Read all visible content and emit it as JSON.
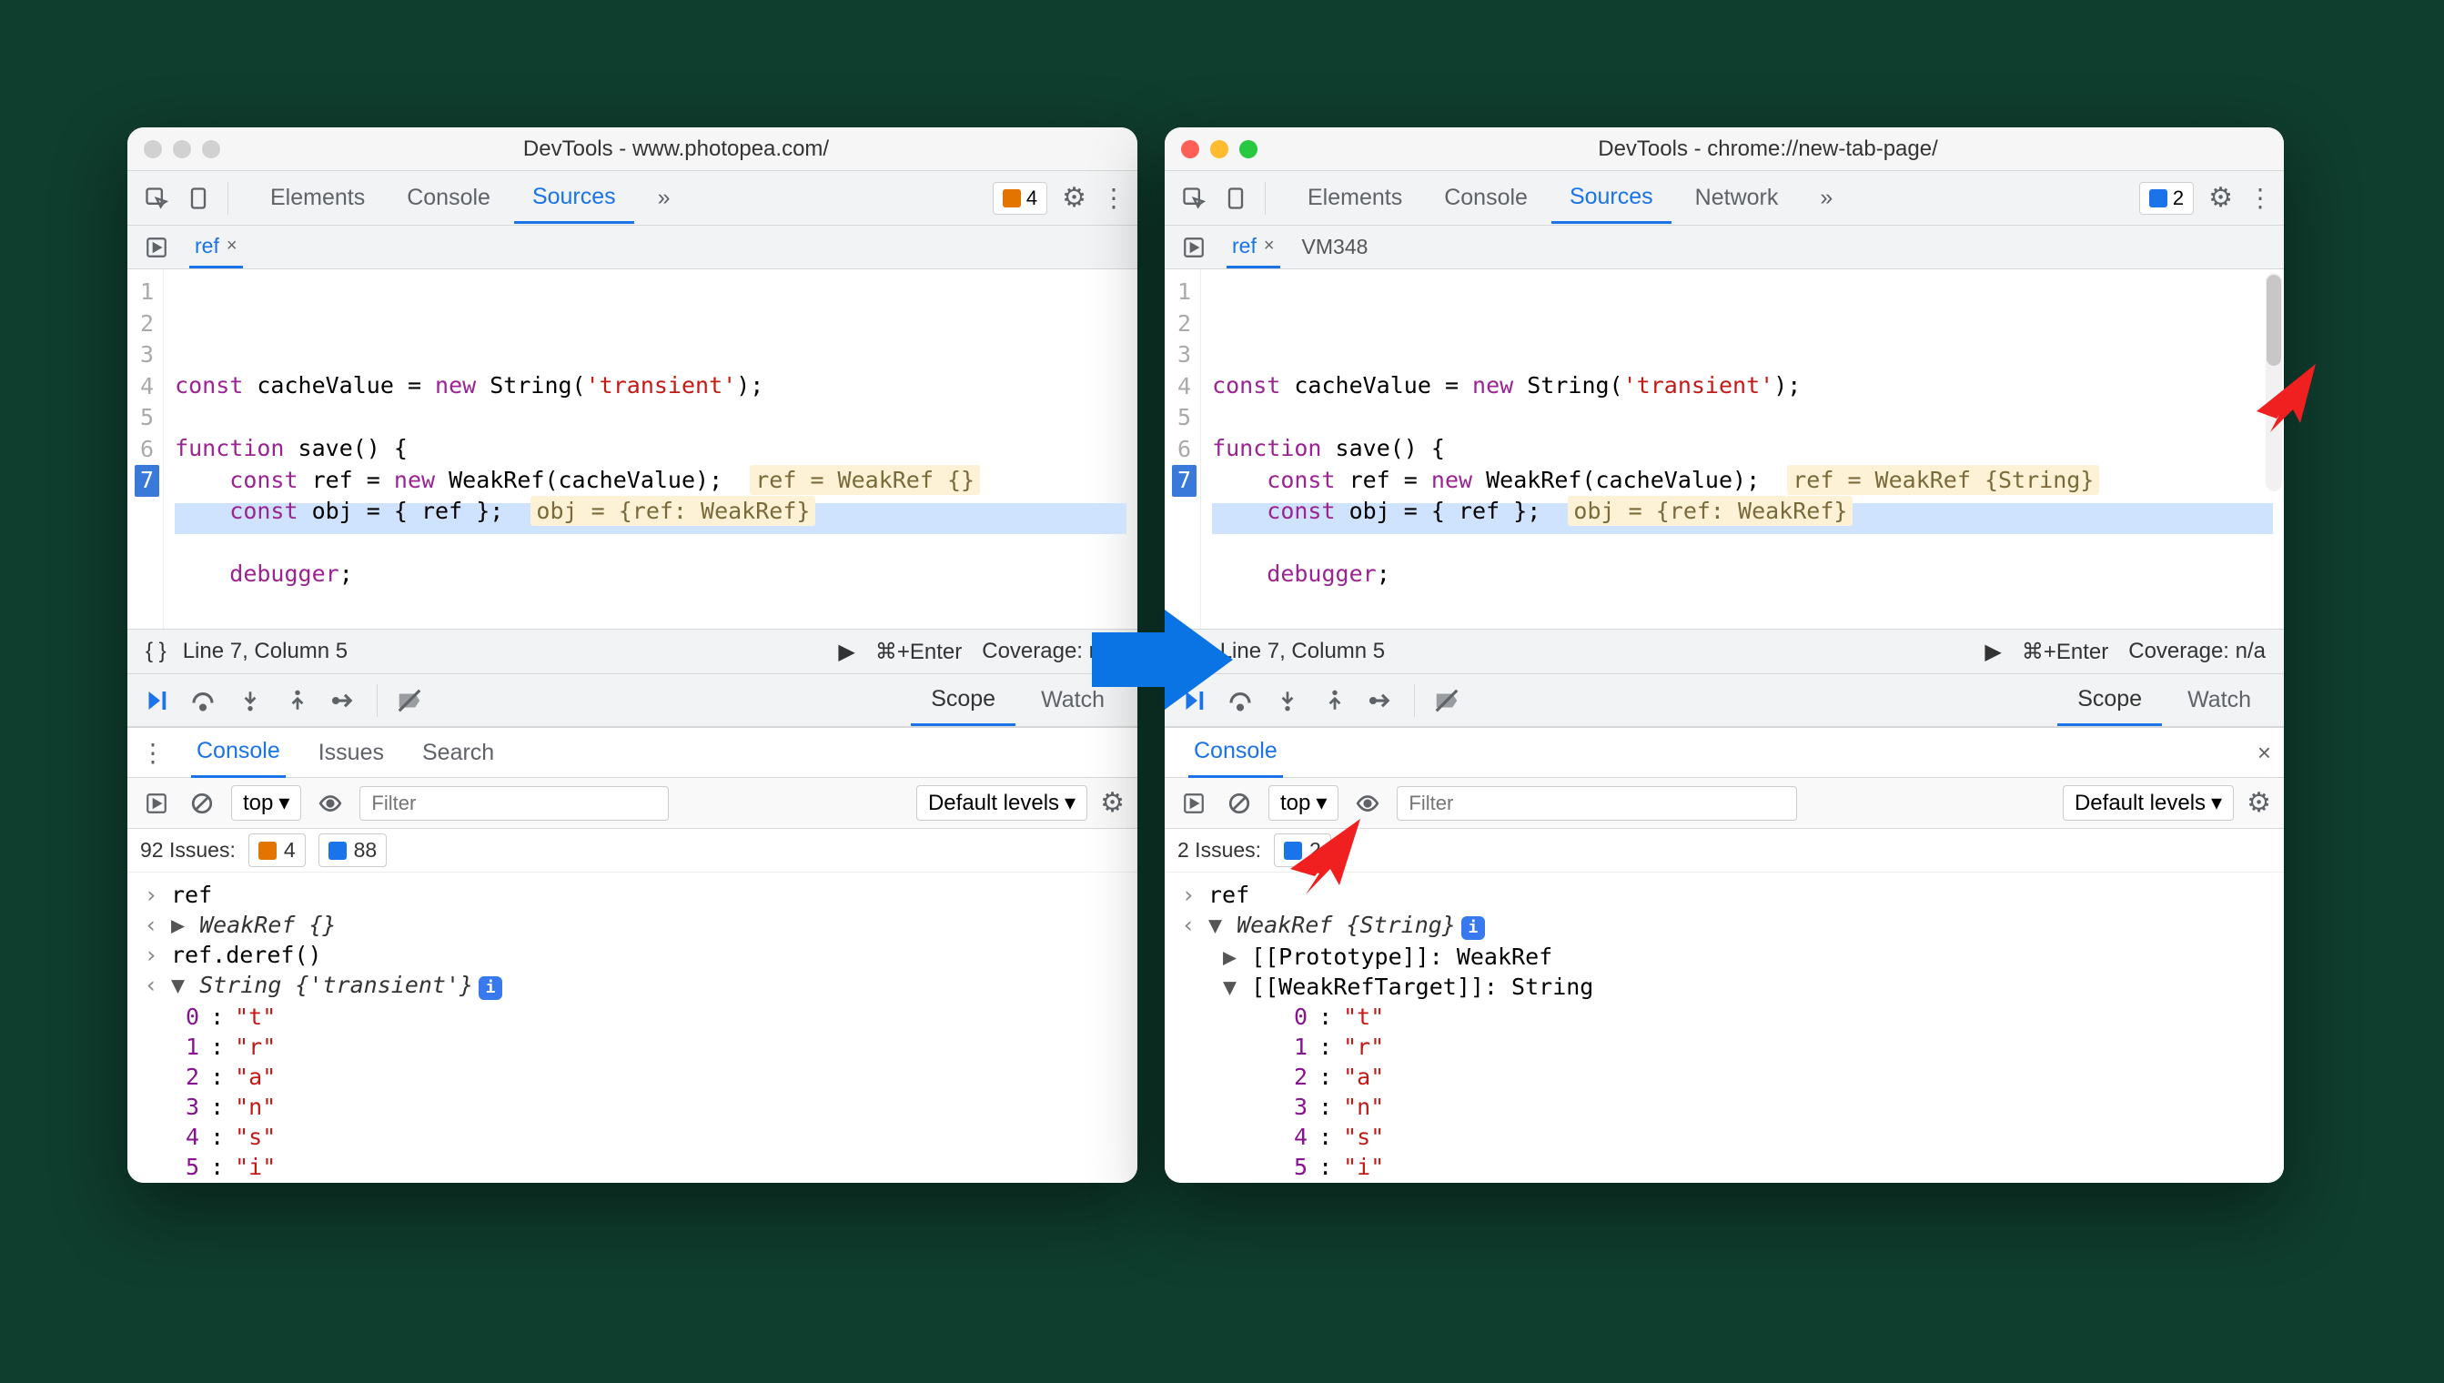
{
  "left": {
    "title": "DevTools - www.photopea.com/",
    "tabs": [
      "Elements",
      "Console",
      "Sources"
    ],
    "activeTab": "Sources",
    "badgeOrange": "4",
    "fileTabs": {
      "active": "ref"
    },
    "code": {
      "lines": [
        "1",
        "2",
        "3",
        "4",
        "5",
        "6",
        "7"
      ],
      "t1a": "const",
      "t1b": " cacheValue = ",
      "t1c": "new",
      "t1d": " String(",
      "t1e": "'transient'",
      "t1f": ");",
      "t3a": "function",
      "t3b": " save() {",
      "t4a": "    const",
      "t4b": " ref = ",
      "t4c": "new",
      "t4d": " WeakRef(cacheValue);  ",
      "t4hint": "ref = WeakRef {}",
      "t5a": "    const",
      "t5b": " obj = { ref };  ",
      "t5hint": "obj = {ref: WeakRef}",
      "t7a": "    debugger",
      "t7b": ";"
    },
    "status": {
      "pos": "Line 7, Column 5",
      "run": "⌘+Enter",
      "coverage": "Coverage: n/a"
    },
    "scope": {
      "tabs": [
        "Scope",
        "Watch"
      ],
      "active": "Scope"
    },
    "drawer": {
      "tabs": [
        "Console",
        "Issues",
        "Search"
      ],
      "active": "Console"
    },
    "filter": {
      "context": "top",
      "placeholder": "Filter",
      "levels": "Default levels"
    },
    "issues": {
      "count": "92 Issues:",
      "orange": "4",
      "blue": "88"
    },
    "console": {
      "r1": "ref",
      "r2": "WeakRef {}",
      "r3": "ref.deref()",
      "r4": "String {'transient'}",
      "chars": [
        {
          "k": "0",
          "v": "\"t\""
        },
        {
          "k": "1",
          "v": "\"r\""
        },
        {
          "k": "2",
          "v": "\"a\""
        },
        {
          "k": "3",
          "v": "\"n\""
        },
        {
          "k": "4",
          "v": "\"s\""
        },
        {
          "k": "5",
          "v": "\"i\""
        }
      ]
    }
  },
  "right": {
    "title": "DevTools - chrome://new-tab-page/",
    "tabs": [
      "Elements",
      "Console",
      "Sources",
      "Network"
    ],
    "activeTab": "Sources",
    "badgeBlue": "2",
    "fileTabs": {
      "active": "ref",
      "other": "VM348"
    },
    "code": {
      "lines": [
        "1",
        "2",
        "3",
        "4",
        "5",
        "6",
        "7"
      ],
      "t1a": "const",
      "t1b": " cacheValue = ",
      "t1c": "new",
      "t1d": " String(",
      "t1e": "'transient'",
      "t1f": ");",
      "t3a": "function",
      "t3b": " save() {",
      "t4a": "    const",
      "t4b": " ref = ",
      "t4c": "new",
      "t4d": " WeakRef(cacheValue);  ",
      "t4hint": "ref = WeakRef {String}",
      "t5a": "    const",
      "t5b": " obj = { ref };  ",
      "t5hint": "obj = {ref: WeakRef}",
      "t7a": "    debugger",
      "t7b": ";"
    },
    "status": {
      "pos": "Line 7, Column 5",
      "run": "⌘+Enter",
      "coverage": "Coverage: n/a"
    },
    "scope": {
      "tabs": [
        "Scope",
        "Watch"
      ],
      "active": "Scope"
    },
    "drawer": {
      "tabs": [
        "Console"
      ],
      "active": "Console"
    },
    "filter": {
      "context": "top",
      "placeholder": "Filter",
      "levels": "Default levels"
    },
    "issues": {
      "count": "2 Issues:",
      "blue": "2"
    },
    "console": {
      "r1": "ref",
      "r2": "WeakRef {String}",
      "proto": "[[Prototype]]: WeakRef",
      "target": "[[WeakRefTarget]]: String",
      "chars": [
        {
          "k": "0",
          "v": "\"t\""
        },
        {
          "k": "1",
          "v": "\"r\""
        },
        {
          "k": "2",
          "v": "\"a\""
        },
        {
          "k": "3",
          "v": "\"n\""
        },
        {
          "k": "4",
          "v": "\"s\""
        },
        {
          "k": "5",
          "v": "\"i\""
        }
      ]
    }
  }
}
